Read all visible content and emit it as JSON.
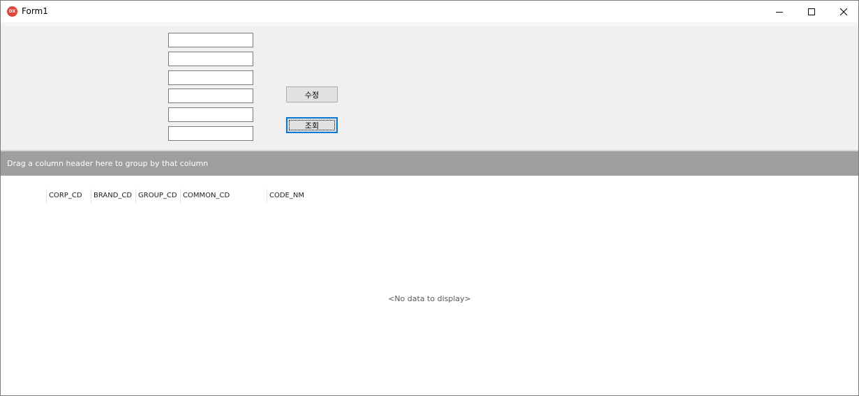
{
  "window": {
    "title": "Form1",
    "icon": "devexpress-icon",
    "icon_text": "DX",
    "controls": [
      "minimize-icon",
      "maximize-icon",
      "close-icon"
    ]
  },
  "form": {
    "textboxes": [
      {
        "value": ""
      },
      {
        "value": ""
      },
      {
        "value": ""
      },
      {
        "value": ""
      },
      {
        "value": ""
      },
      {
        "value": ""
      }
    ],
    "edit_button_label": "수정",
    "search_button_label": "조회"
  },
  "grid": {
    "group_panel_text": "Drag a column header here to group by that column",
    "columns": [
      "CORP_CD",
      "BRAND_CD",
      "GROUP_CD",
      "COMMON_CD",
      "CODE_NM"
    ],
    "empty_text": "<No data to display>"
  },
  "colors": {
    "panel_bg": "#f0f0f0",
    "group_panel_bg": "#9e9e9e",
    "focus_border": "#0078d7",
    "app_icon": "#e2443a"
  }
}
